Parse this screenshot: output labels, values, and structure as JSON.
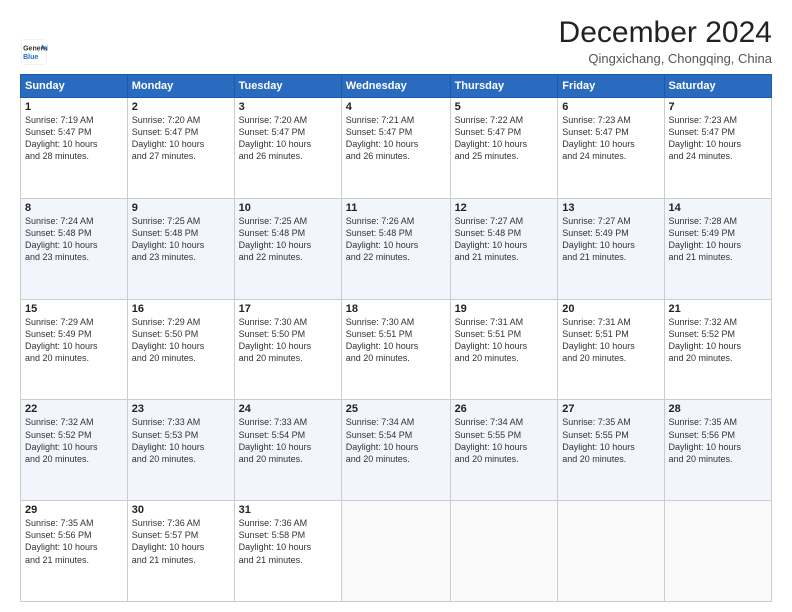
{
  "logo": {
    "line1": "General",
    "line2": "Blue"
  },
  "title": "December 2024",
  "subtitle": "Qingxichang, Chongqing, China",
  "header": {
    "days": [
      "Sunday",
      "Monday",
      "Tuesday",
      "Wednesday",
      "Thursday",
      "Friday",
      "Saturday"
    ]
  },
  "weeks": [
    [
      {
        "day": "1",
        "info": "Sunrise: 7:19 AM\nSunset: 5:47 PM\nDaylight: 10 hours\nand 28 minutes."
      },
      {
        "day": "2",
        "info": "Sunrise: 7:20 AM\nSunset: 5:47 PM\nDaylight: 10 hours\nand 27 minutes."
      },
      {
        "day": "3",
        "info": "Sunrise: 7:20 AM\nSunset: 5:47 PM\nDaylight: 10 hours\nand 26 minutes."
      },
      {
        "day": "4",
        "info": "Sunrise: 7:21 AM\nSunset: 5:47 PM\nDaylight: 10 hours\nand 26 minutes."
      },
      {
        "day": "5",
        "info": "Sunrise: 7:22 AM\nSunset: 5:47 PM\nDaylight: 10 hours\nand 25 minutes."
      },
      {
        "day": "6",
        "info": "Sunrise: 7:23 AM\nSunset: 5:47 PM\nDaylight: 10 hours\nand 24 minutes."
      },
      {
        "day": "7",
        "info": "Sunrise: 7:23 AM\nSunset: 5:47 PM\nDaylight: 10 hours\nand 24 minutes."
      }
    ],
    [
      {
        "day": "8",
        "info": "Sunrise: 7:24 AM\nSunset: 5:48 PM\nDaylight: 10 hours\nand 23 minutes."
      },
      {
        "day": "9",
        "info": "Sunrise: 7:25 AM\nSunset: 5:48 PM\nDaylight: 10 hours\nand 23 minutes."
      },
      {
        "day": "10",
        "info": "Sunrise: 7:25 AM\nSunset: 5:48 PM\nDaylight: 10 hours\nand 22 minutes."
      },
      {
        "day": "11",
        "info": "Sunrise: 7:26 AM\nSunset: 5:48 PM\nDaylight: 10 hours\nand 22 minutes."
      },
      {
        "day": "12",
        "info": "Sunrise: 7:27 AM\nSunset: 5:48 PM\nDaylight: 10 hours\nand 21 minutes."
      },
      {
        "day": "13",
        "info": "Sunrise: 7:27 AM\nSunset: 5:49 PM\nDaylight: 10 hours\nand 21 minutes."
      },
      {
        "day": "14",
        "info": "Sunrise: 7:28 AM\nSunset: 5:49 PM\nDaylight: 10 hours\nand 21 minutes."
      }
    ],
    [
      {
        "day": "15",
        "info": "Sunrise: 7:29 AM\nSunset: 5:49 PM\nDaylight: 10 hours\nand 20 minutes."
      },
      {
        "day": "16",
        "info": "Sunrise: 7:29 AM\nSunset: 5:50 PM\nDaylight: 10 hours\nand 20 minutes."
      },
      {
        "day": "17",
        "info": "Sunrise: 7:30 AM\nSunset: 5:50 PM\nDaylight: 10 hours\nand 20 minutes."
      },
      {
        "day": "18",
        "info": "Sunrise: 7:30 AM\nSunset: 5:51 PM\nDaylight: 10 hours\nand 20 minutes."
      },
      {
        "day": "19",
        "info": "Sunrise: 7:31 AM\nSunset: 5:51 PM\nDaylight: 10 hours\nand 20 minutes."
      },
      {
        "day": "20",
        "info": "Sunrise: 7:31 AM\nSunset: 5:51 PM\nDaylight: 10 hours\nand 20 minutes."
      },
      {
        "day": "21",
        "info": "Sunrise: 7:32 AM\nSunset: 5:52 PM\nDaylight: 10 hours\nand 20 minutes."
      }
    ],
    [
      {
        "day": "22",
        "info": "Sunrise: 7:32 AM\nSunset: 5:52 PM\nDaylight: 10 hours\nand 20 minutes."
      },
      {
        "day": "23",
        "info": "Sunrise: 7:33 AM\nSunset: 5:53 PM\nDaylight: 10 hours\nand 20 minutes."
      },
      {
        "day": "24",
        "info": "Sunrise: 7:33 AM\nSunset: 5:54 PM\nDaylight: 10 hours\nand 20 minutes."
      },
      {
        "day": "25",
        "info": "Sunrise: 7:34 AM\nSunset: 5:54 PM\nDaylight: 10 hours\nand 20 minutes."
      },
      {
        "day": "26",
        "info": "Sunrise: 7:34 AM\nSunset: 5:55 PM\nDaylight: 10 hours\nand 20 minutes."
      },
      {
        "day": "27",
        "info": "Sunrise: 7:35 AM\nSunset: 5:55 PM\nDaylight: 10 hours\nand 20 minutes."
      },
      {
        "day": "28",
        "info": "Sunrise: 7:35 AM\nSunset: 5:56 PM\nDaylight: 10 hours\nand 20 minutes."
      }
    ],
    [
      {
        "day": "29",
        "info": "Sunrise: 7:35 AM\nSunset: 5:56 PM\nDaylight: 10 hours\nand 21 minutes."
      },
      {
        "day": "30",
        "info": "Sunrise: 7:36 AM\nSunset: 5:57 PM\nDaylight: 10 hours\nand 21 minutes."
      },
      {
        "day": "31",
        "info": "Sunrise: 7:36 AM\nSunset: 5:58 PM\nDaylight: 10 hours\nand 21 minutes."
      },
      {
        "day": "",
        "info": ""
      },
      {
        "day": "",
        "info": ""
      },
      {
        "day": "",
        "info": ""
      },
      {
        "day": "",
        "info": ""
      }
    ]
  ]
}
